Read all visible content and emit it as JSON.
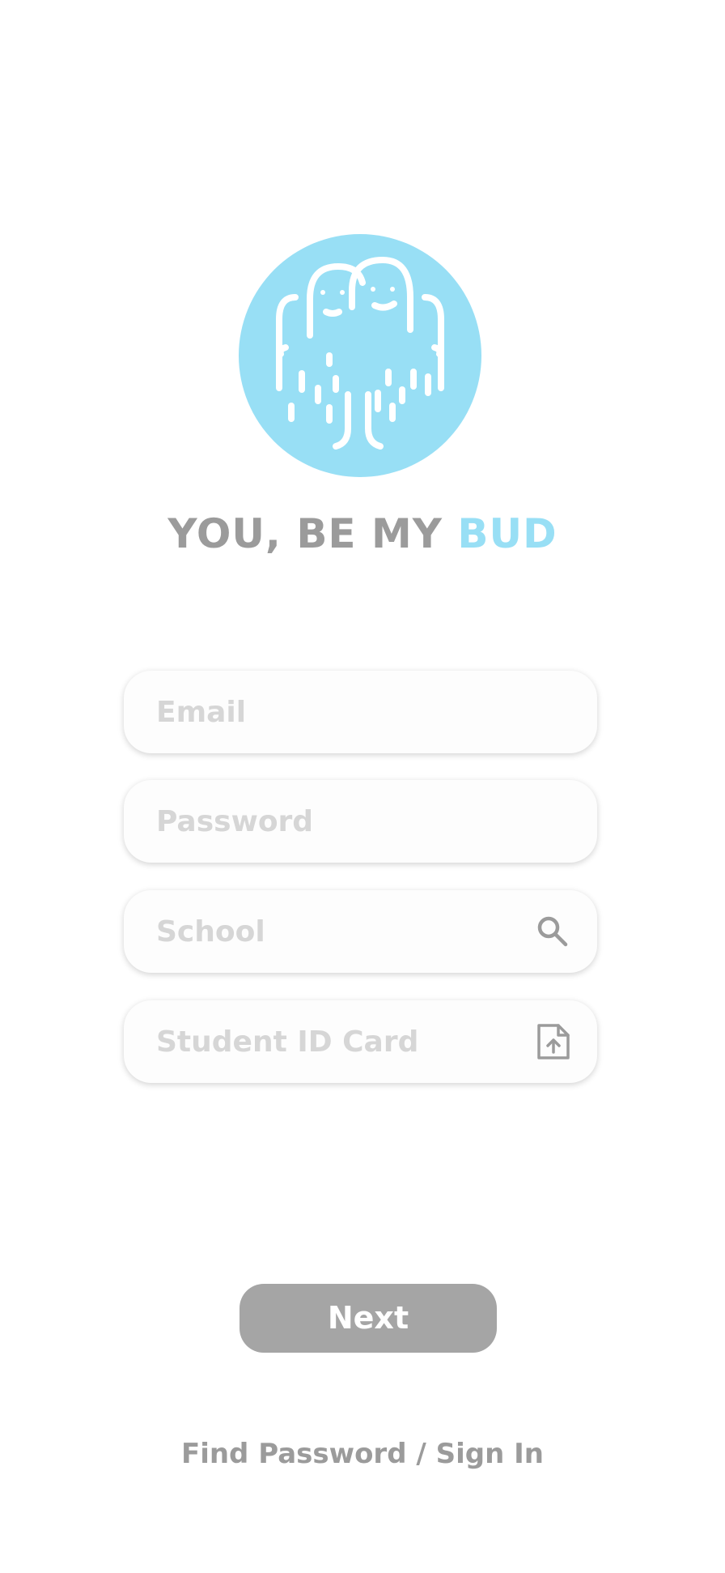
{
  "brand": {
    "title_main": "YOU, BE MY ",
    "title_accent": "BUD",
    "logo_icon": "buddies-logo-icon",
    "accent_color": "#98dff5",
    "text_color": "#9b9b9b"
  },
  "form": {
    "email_placeholder": "Email",
    "password_placeholder": "Password",
    "school_placeholder": "School",
    "school_icon": "search-icon",
    "student_id_placeholder": "Student ID Card",
    "student_id_icon": "upload-file-icon"
  },
  "actions": {
    "next_label": "Next",
    "button_color": "#a5a5a5"
  },
  "footer": {
    "find_password": "Find Password",
    "separator": " / ",
    "sign_in": "Sign In"
  }
}
